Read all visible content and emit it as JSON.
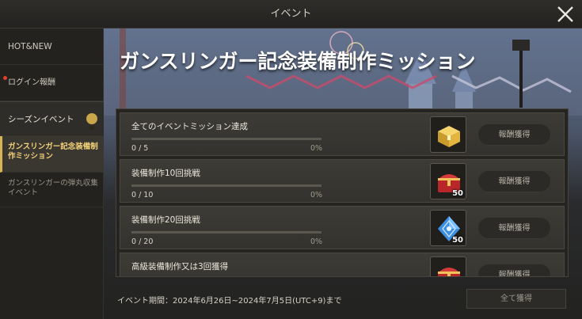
{
  "window": {
    "title": "イベント"
  },
  "sidebar": {
    "items": [
      {
        "label": "HOT&NEW"
      },
      {
        "label": "ログイン報酬"
      },
      {
        "label": "シーズンイベント"
      },
      {
        "label": "ガンスリンガー記念装備制作ミッション"
      },
      {
        "label": "ガンスリンガーの弾丸収集イベント"
      }
    ]
  },
  "main": {
    "title": "ガンスリンガー記念装備制作ミッション",
    "missions": [
      {
        "title": "全てのイベントミッション達成",
        "progress": "0 / 5",
        "percent": "0%",
        "fraction": 0,
        "reward_icon": "gold-chest-icon",
        "reward_qty": "",
        "button_label": "報酬獲得"
      },
      {
        "title": "装備制作10回挑戦",
        "progress": "0 / 10",
        "percent": "0%",
        "fraction": 0,
        "reward_icon": "red-chest-icon",
        "reward_qty": "50",
        "button_label": "報酬獲得"
      },
      {
        "title": "装備制作20回挑戦",
        "progress": "0 / 20",
        "percent": "0%",
        "fraction": 0,
        "reward_icon": "blue-crystal-icon",
        "reward_qty": "50",
        "button_label": "報酬獲得"
      },
      {
        "title": "高級装備制作又は3回獲得",
        "reward_icon": "red-chest-icon",
        "button_label": "報酬獲得"
      }
    ],
    "period": "イベント期間：2024年6月26日~2024年7月5日(UTC+9)まで",
    "claim_all_label": "全て獲得"
  },
  "colors": {
    "accent": "#d6b356",
    "notification": "#e0412c"
  }
}
